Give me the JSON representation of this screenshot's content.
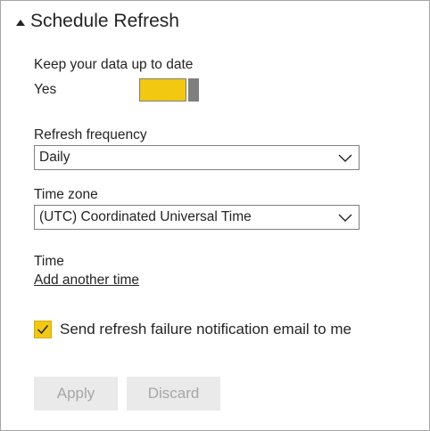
{
  "section": {
    "title": "Schedule Refresh",
    "caret_icon": "caret-up-icon"
  },
  "keep_up_to_date": {
    "label": "Keep your data up to date",
    "state_label": "Yes",
    "enabled": true,
    "toggle_color": "#f2c811"
  },
  "refresh_frequency": {
    "label": "Refresh frequency",
    "value": "Daily",
    "icon": "chevron-down-icon"
  },
  "time_zone": {
    "label": "Time zone",
    "value": "(UTC) Coordinated Universal Time",
    "icon": "chevron-down-icon"
  },
  "time": {
    "label": "Time",
    "add_link": "Add another time"
  },
  "notification": {
    "label": "Send refresh failure notification email to me",
    "checked": true,
    "checkbox_color": "#f2c811"
  },
  "buttons": {
    "apply": "Apply",
    "discard": "Discard",
    "disabled": true
  }
}
